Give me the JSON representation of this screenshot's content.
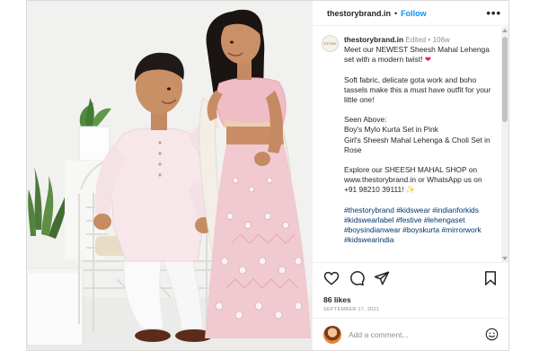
{
  "header": {
    "username": "thestorybrand.in",
    "separator": "•",
    "follow_label": "Follow",
    "more_label": "•••"
  },
  "caption": {
    "avatar_text": "STORY",
    "username": "thestorybrand.in",
    "edited": "Edited",
    "separator": "•",
    "age": "106w",
    "line1": "Meet our NEWEST Sheesh Mahal Lehenga set with a modern twist!",
    "heart": "❤",
    "para2": "Soft fabric, delicate gota work and boho tassels make this a must have outfit for your little one!",
    "seen_above": "Seen Above:",
    "item1": "Boy's Mylo Kurta Set in Pink",
    "item2": "Girl's Sheesh Mahal Lehenga & Choli Set in Rose",
    "explore": "Explore our SHEESH MAHAL SHOP on www.thestorybrand.in or WhatsApp us on +91 98210 39111!",
    "star": "✨",
    "hashtags": "#thestorybrand #kidswear #indianforkids #kidswearlabel #festive #lehengaset #boysindianwear #boyskurta #mirrorwork #kidswearindia"
  },
  "engagement": {
    "likes": "86 likes",
    "date": "SEPTEMBER 17, 2021"
  },
  "comment_box": {
    "placeholder": "Add a comment..."
  },
  "icons": [
    "heart-icon",
    "comment-icon",
    "share-icon",
    "bookmark-icon",
    "emoji-icon",
    "more-options-icon"
  ],
  "colors": {
    "link_blue": "#0095f6",
    "hashtag": "#00376b",
    "muted": "#8e8e8e",
    "text": "#262626"
  }
}
